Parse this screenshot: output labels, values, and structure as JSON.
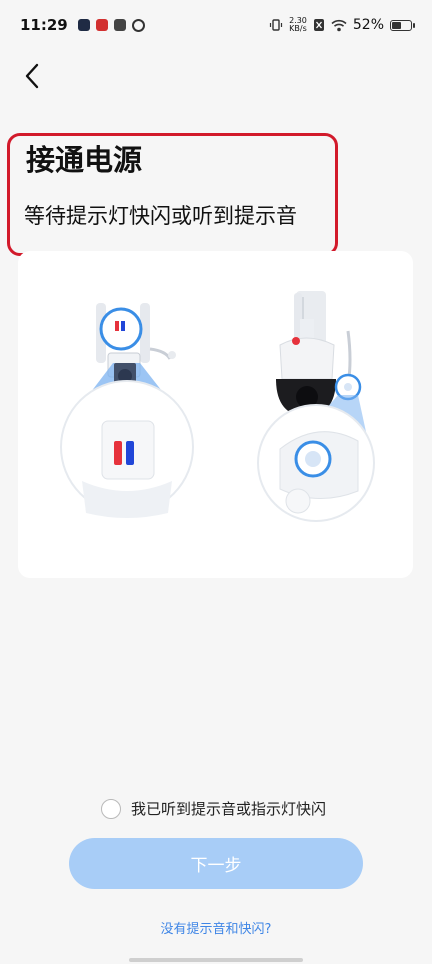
{
  "status_bar": {
    "time": "11:29",
    "net_speed_value": "2.30",
    "net_speed_unit": "KB/s",
    "battery": "52%",
    "battery_level": 0.52,
    "app_icons": [
      "play-app-icon",
      "red-app-icon",
      "box-app-icon",
      "loop-app-icon"
    ],
    "icons": [
      "vibrate-icon",
      "sim-off-icon",
      "wifi-icon",
      "battery-icon"
    ]
  },
  "header": {
    "back_icon": "chevron-left-icon"
  },
  "main": {
    "title": "接通电源",
    "subtitle": "等待提示灯快闪或听到提示音",
    "highlight_color": "#d21a2b",
    "illustration": {
      "left_device_icon": "camera-indicator-light-icon",
      "right_device_icon": "ptz-camera-indicator-icon",
      "light_colors": [
        "#e6323c",
        "#2146d8"
      ]
    }
  },
  "footer": {
    "confirm_label": "我已听到提示音或指示灯快闪",
    "confirm_checked": false,
    "next_label": "下一步",
    "help_link": "没有提示音和快闪?",
    "accent_color": "#3f86e6",
    "button_color": "#a8cdf7"
  }
}
